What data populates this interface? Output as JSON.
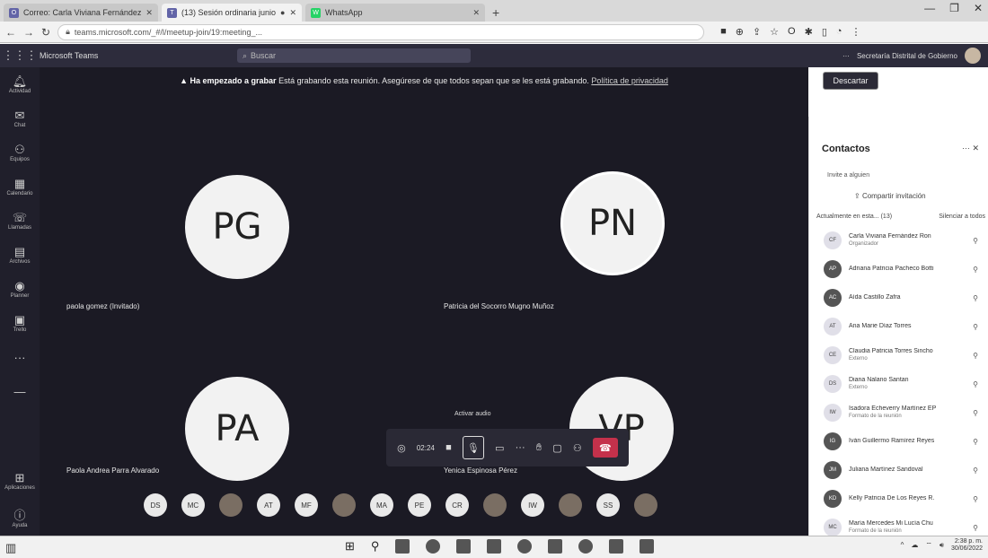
{
  "browser": {
    "tabs": [
      {
        "label": "Correo: Carla Viviana Fernández",
        "active": false
      },
      {
        "label": "(13) Sesión ordinaria junio",
        "active": true
      },
      {
        "label": "WhatsApp",
        "active": false
      }
    ],
    "url": "teams.microsoft.com/_#/l/meetup-join/19:meeting_..."
  },
  "teams": {
    "brand": "Microsoft Teams",
    "search_placeholder": "Buscar",
    "user_org": "Secretaría Distrital de Gobierno",
    "rail": [
      "Actividad",
      "Chat",
      "Equipos",
      "Calendario",
      "Llamadas",
      "Archivos",
      "Planner",
      "Trello",
      "OneDrive",
      "Aplicaciones",
      "Ayuda"
    ]
  },
  "banner": {
    "warn_icon": "▲",
    "bold": "Ha empezado a grabar",
    "text": "Está grabando esta reunión. Asegúrese de que todos sepan que se les está grabando.",
    "link": "Política de privacidad",
    "dismiss": "Descartar"
  },
  "tiles": [
    {
      "initials": "PG",
      "name": "paola gomez (Invitado)"
    },
    {
      "initials": "PN",
      "name": "Patricia del Socorro Mugno Muñoz"
    },
    {
      "initials": "PA",
      "name": "Paola Andrea Parra Alvarado"
    },
    {
      "initials": "VP",
      "name": "Yenica Espinosa Pérez"
    }
  ],
  "controls": {
    "tooltip": "Activar audio",
    "timer": "02:24"
  },
  "avatar_row": [
    "DS",
    "MC",
    "",
    "AT",
    "MF",
    "",
    "MA",
    "PE",
    "CR",
    "",
    "IW",
    "",
    "SS",
    ""
  ],
  "panel": {
    "title": "Contactos",
    "invite_label": "Invite a alguien",
    "share_invite": "Compartir invitación",
    "in_meeting": "Actualmente en esta... (13)",
    "mute_all": "Silenciar a todos",
    "contacts": [
      {
        "initials": "CF",
        "name": "Carla Viviana Fernández Ron",
        "sub": "Organizador",
        "dark": false
      },
      {
        "initials": "AP",
        "name": "Adriana Patricia Pacheco Botti",
        "sub": "",
        "dark": true
      },
      {
        "initials": "AC",
        "name": "Aída Castillo Zafra",
        "sub": "",
        "dark": true
      },
      {
        "initials": "AT",
        "name": "Ana Marie Díaz Torres",
        "sub": "",
        "dark": false
      },
      {
        "initials": "CE",
        "name": "Claudia Patricia Torres Sincho",
        "sub": "Externo",
        "dark": false
      },
      {
        "initials": "DS",
        "name": "Diana Nalano Santan",
        "sub": "Externo",
        "dark": false
      },
      {
        "initials": "IW",
        "name": "Isadora Echeverry Martínez EP",
        "sub": "Formato de la reunión",
        "dark": false
      },
      {
        "initials": "IG",
        "name": "Iván Guillermo Ramírez Reyes",
        "sub": "",
        "dark": true
      },
      {
        "initials": "JM",
        "name": "Juliana Martínez Sandoval",
        "sub": "",
        "dark": true
      },
      {
        "initials": "KD",
        "name": "Kelly Patricia De Los Reyes R.",
        "sub": "",
        "dark": true
      },
      {
        "initials": "MC",
        "name": "María Mercedes Mi Lucía Chu",
        "sub": "Formato de la reunión",
        "dark": false
      }
    ]
  },
  "taskbar": {
    "time": "2:38 p. m.",
    "date": "30/06/2022"
  }
}
